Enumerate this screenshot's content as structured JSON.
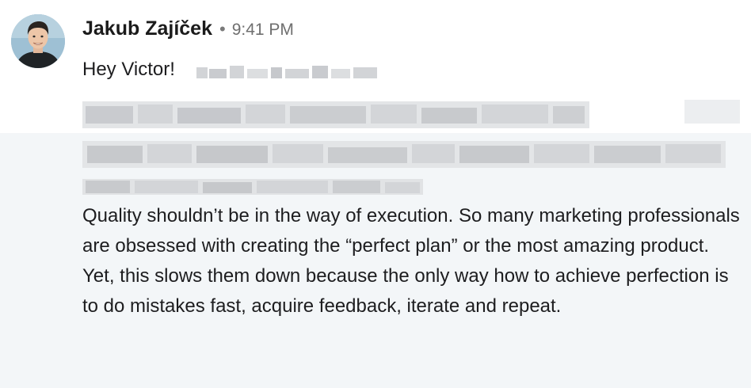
{
  "message": {
    "author_name": "Jakub Zajíček",
    "separator": "•",
    "timestamp": "9:41 PM",
    "greeting": "Hey Victor!",
    "body_text": "Quality shouldn’t be in the way of execution. So many marketing professionals are obsessed with creating the “perfect plan” or the most amazing product. Yet, this slows them down because the only way how to achieve perfection is to do mistakes fast, acquire feedback, iterate and repeat."
  },
  "colors": {
    "upper_background": "#ffffff",
    "lower_background": "#f3f6f8",
    "text": "#1d1d1f",
    "timestamp": "#6f6f6f",
    "blur_pixels": "#cfd1d4"
  },
  "icons": {
    "avatar": "person-portrait"
  }
}
